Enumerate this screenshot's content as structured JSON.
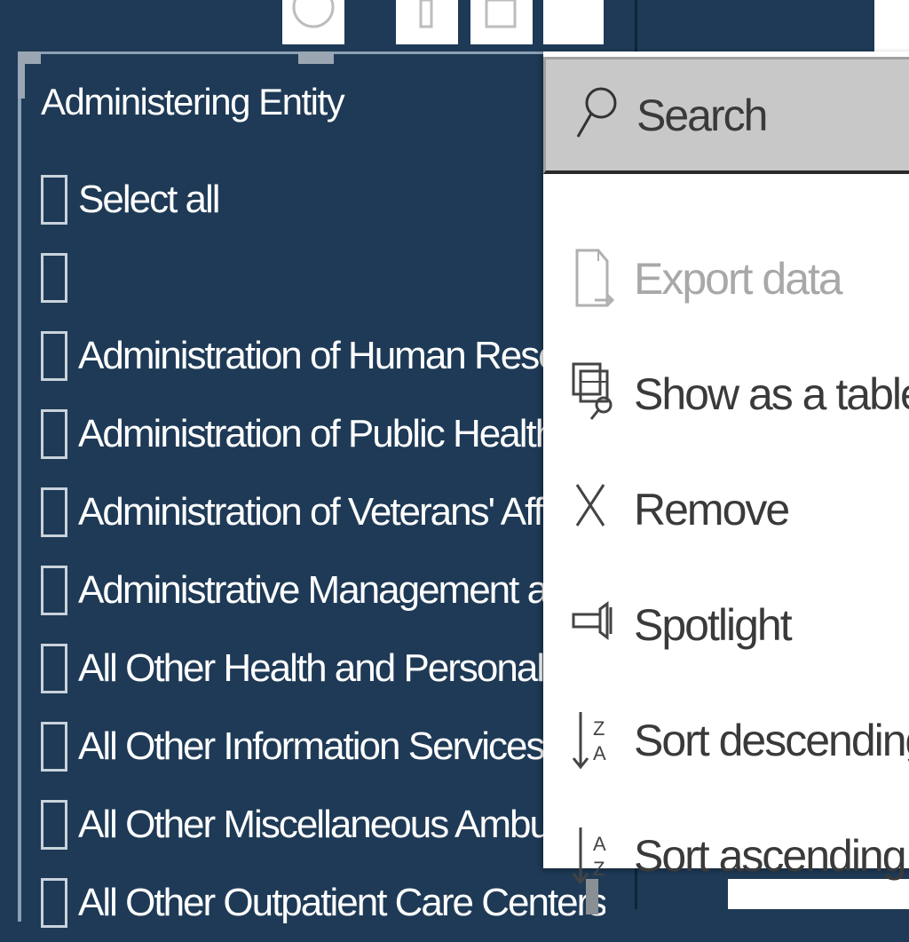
{
  "slicer": {
    "title": "Administering Entity",
    "items": [
      {
        "label": "Select all"
      },
      {
        "label": ""
      },
      {
        "label": "Administration of Human Resources"
      },
      {
        "label": "Administration of Public Health Programs"
      },
      {
        "label": "Administration of Veterans' Affairs"
      },
      {
        "label": "Administrative Management and General"
      },
      {
        "label": "All Other Health and Personal Care"
      },
      {
        "label": "All Other Information Services"
      },
      {
        "label": "All Other Miscellaneous Ambulatory"
      },
      {
        "label": "All Other Outpatient Care Centers"
      }
    ]
  },
  "menu": {
    "items": [
      {
        "label": "Search",
        "icon": "search-icon",
        "state": "active"
      },
      {
        "label": "Export data",
        "icon": "export-data-icon",
        "state": "disabled"
      },
      {
        "label": "Show as a table",
        "icon": "show-as-table-icon",
        "state": "normal"
      },
      {
        "label": "Remove",
        "icon": "remove-icon",
        "state": "normal"
      },
      {
        "label": "Spotlight",
        "icon": "spotlight-icon",
        "state": "normal"
      },
      {
        "label": "Sort descending",
        "icon": "sort-descending-icon",
        "state": "normal"
      },
      {
        "label": "Sort ascending",
        "icon": "sort-ascending-icon",
        "state": "normal"
      }
    ]
  },
  "toolbar": {
    "buttons": [
      {
        "icon": "pin-icon"
      },
      {
        "icon": "filter-icon"
      },
      {
        "icon": "focus-mode-icon"
      },
      {
        "icon": "more-options-icon"
      }
    ]
  },
  "colors": {
    "canvas": "#1e3a56",
    "menu_bg": "#ffffff",
    "menu_active": "#c8c8c8",
    "text_primary": "#ffffff",
    "text_menu": "#3a3a3a",
    "text_disabled": "#a8a8a8"
  }
}
